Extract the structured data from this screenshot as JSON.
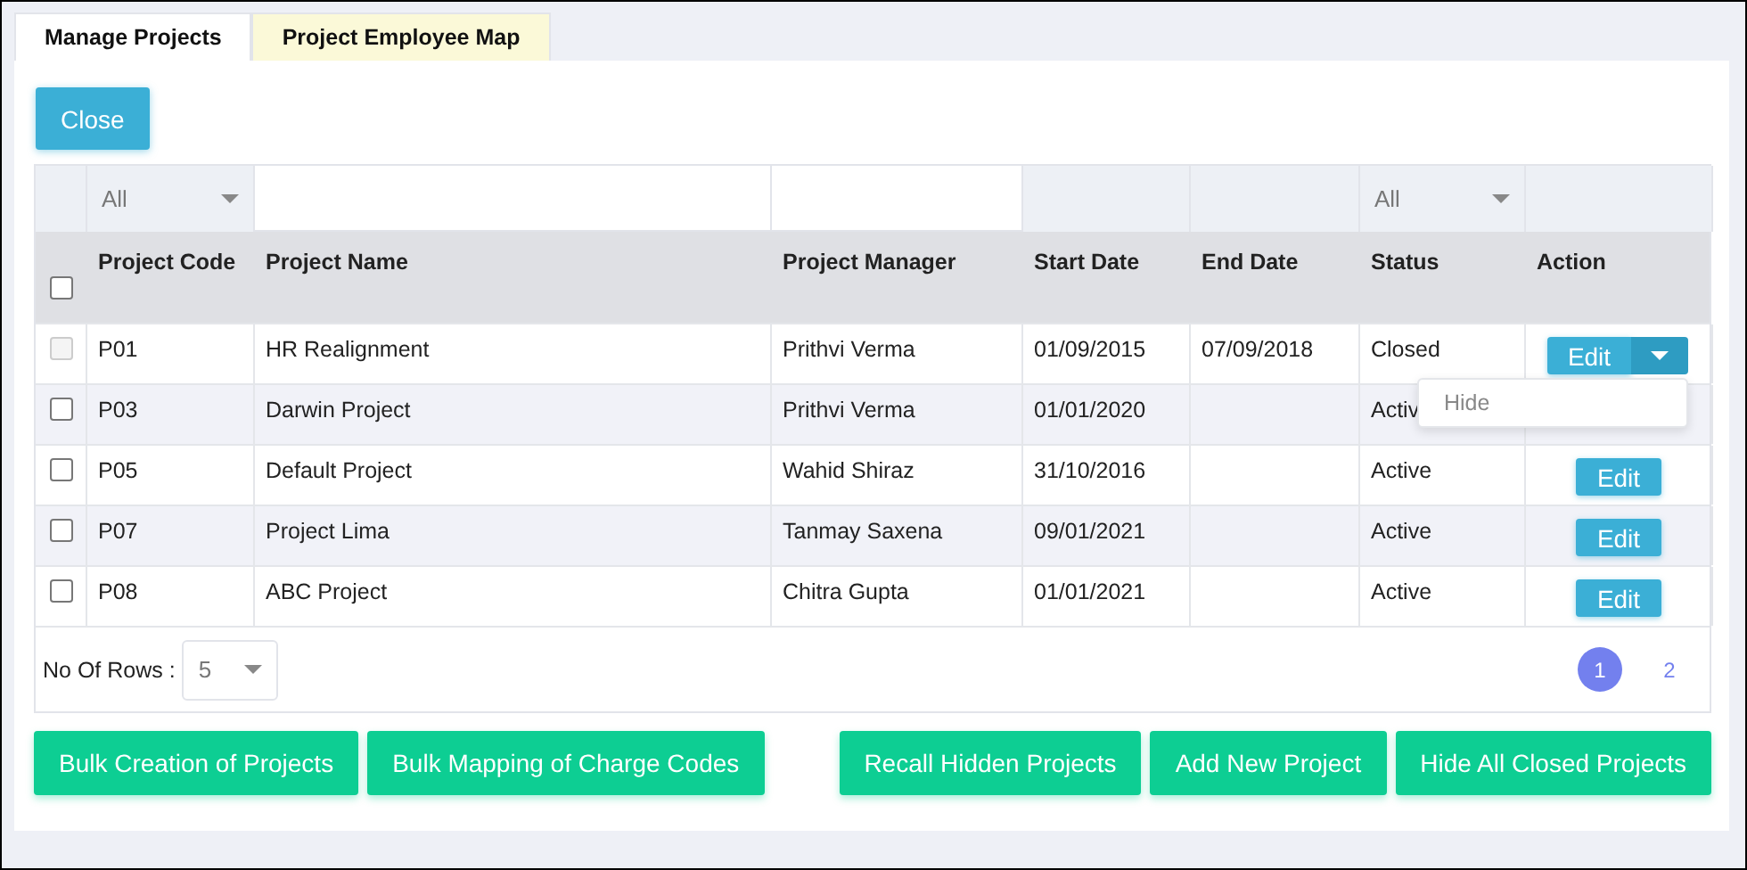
{
  "tabs": [
    {
      "label": "Manage Projects",
      "selected": true
    },
    {
      "label": "Project Employee Map",
      "selected": false
    }
  ],
  "close_button": "Close",
  "table": {
    "filters": [
      {
        "kind": "none"
      },
      {
        "kind": "select",
        "value": "All"
      },
      {
        "kind": "input"
      },
      {
        "kind": "input"
      },
      {
        "kind": "none"
      },
      {
        "kind": "none"
      },
      {
        "kind": "select",
        "value": "All"
      },
      {
        "kind": "none"
      }
    ],
    "select_all": {
      "checked": false
    },
    "columns": [
      "Project Code",
      "Project Name",
      "Project Manager",
      "Start Date",
      "End Date",
      "Status",
      "Action"
    ],
    "rows": [
      {
        "checked": false,
        "disabled": true,
        "cells": [
          "P01",
          "HR Realignment",
          "Prithvi Verma",
          "01/09/2015",
          "07/09/2018",
          "Closed"
        ],
        "action": {
          "kind": "split",
          "label": "Edit",
          "menu_open": true,
          "menu": [
            "Hide"
          ]
        }
      },
      {
        "checked": false,
        "disabled": false,
        "cells": [
          "P03",
          "Darwin Project",
          "Prithvi Verma",
          "01/01/2020",
          "",
          "Activ"
        ],
        "action": {
          "kind": "covered"
        }
      },
      {
        "checked": false,
        "disabled": false,
        "cells": [
          "P05",
          "Default Project",
          "Wahid Shiraz",
          "31/10/2016",
          "",
          "Active"
        ],
        "action": {
          "kind": "edit",
          "label": "Edit"
        }
      },
      {
        "checked": false,
        "disabled": false,
        "cells": [
          "P07",
          "Project Lima",
          "Tanmay Saxena",
          "09/01/2021",
          "",
          "Active"
        ],
        "action": {
          "kind": "edit",
          "label": "Edit"
        }
      },
      {
        "checked": false,
        "disabled": false,
        "cells": [
          "P08",
          "ABC Project",
          "Chitra Gupta",
          "01/01/2021",
          "",
          "Active"
        ],
        "action": {
          "kind": "edit",
          "label": "Edit"
        }
      }
    ],
    "rows_label": "No Of Rows :",
    "rows_per_page": "5",
    "pages": [
      {
        "label": "1",
        "selected": true
      },
      {
        "label": "2",
        "selected": false
      }
    ]
  },
  "left_buttons": [
    "Bulk Creation of Projects",
    "Bulk Mapping of Charge Codes"
  ],
  "right_buttons": [
    "Recall Hidden Projects",
    "Add New Project",
    "Hide All Closed Projects"
  ]
}
